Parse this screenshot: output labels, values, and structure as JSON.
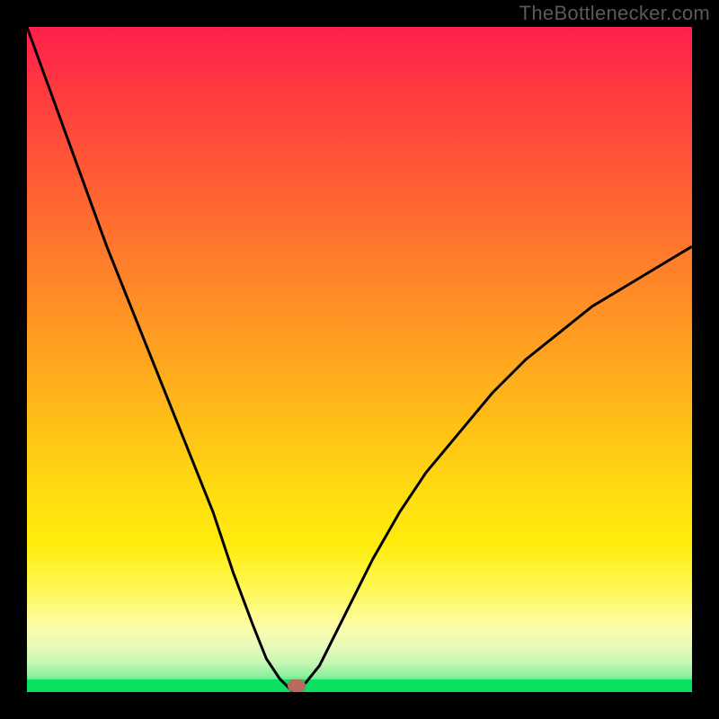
{
  "watermark": "TheBottlenecker.com",
  "chart_data": {
    "type": "line",
    "title": "",
    "xlabel": "",
    "ylabel": "",
    "xlim": [
      0,
      100
    ],
    "ylim": [
      0,
      100
    ],
    "x": [
      0,
      4,
      8,
      12,
      16,
      20,
      24,
      28,
      31,
      34,
      36,
      38,
      39,
      40,
      41,
      42,
      44,
      46,
      48,
      52,
      56,
      60,
      65,
      70,
      75,
      80,
      85,
      90,
      95,
      100
    ],
    "values": [
      100,
      89,
      78,
      67,
      57,
      47,
      37,
      27,
      18,
      10,
      5,
      2,
      1,
      0,
      0.5,
      1.5,
      4,
      8,
      12,
      20,
      27,
      33,
      39,
      45,
      50,
      54,
      58,
      61,
      64,
      67
    ],
    "minimum": {
      "x": 40,
      "y": 0
    },
    "marker": {
      "x": 40.5,
      "y": 1
    },
    "background_gradient": {
      "direction": "vertical",
      "stops": [
        {
          "pos": 0,
          "color": "#ff1f4b"
        },
        {
          "pos": 50,
          "color": "#ffb81a"
        },
        {
          "pos": 80,
          "color": "#fff24a"
        },
        {
          "pos": 100,
          "color": "#0be060"
        }
      ]
    }
  },
  "colors": {
    "frame": "#000000",
    "curve": "#000000",
    "marker": "#b96a5e",
    "watermark": "#5a5a5a"
  }
}
